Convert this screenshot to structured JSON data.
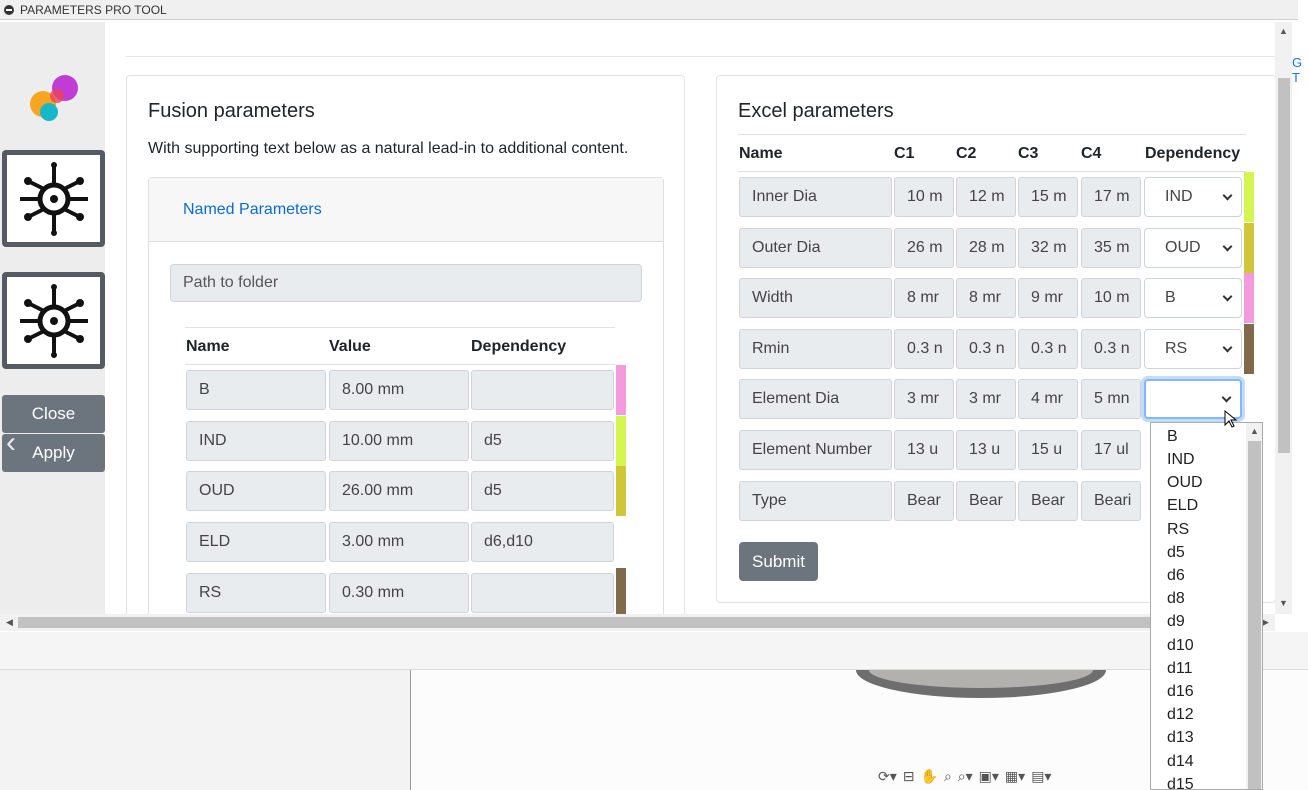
{
  "window": {
    "title": "PARAMETERS PRO TOOL",
    "edge_tab_label": "G T"
  },
  "sidebar": {
    "close_label": "Close",
    "apply_label": "Apply"
  },
  "fusion": {
    "title": "Fusion parameters",
    "lead": "With supporting text below as a natural lead-in to additional content.",
    "link": "Named Parameters",
    "path_placeholder": "Path to folder",
    "headers": [
      "Name",
      "Value",
      "Dependency"
    ],
    "rows": [
      {
        "name": "B",
        "value": "8.00 mm",
        "dependency": "",
        "color": "#f49ade"
      },
      {
        "name": "IND",
        "value": "10.00 mm",
        "dependency": "d5",
        "color": "#d5f552"
      },
      {
        "name": "OUD",
        "value": "26.00 mm",
        "dependency": "d5",
        "color": "#cfc63a"
      },
      {
        "name": "ELD",
        "value": "3.00 mm",
        "dependency": "d6,d10",
        "color": ""
      },
      {
        "name": "RS",
        "value": "0.30 mm",
        "dependency": "",
        "color": "#81694c"
      }
    ]
  },
  "excel": {
    "title": "Excel parameters",
    "headers": [
      "Name",
      "C1",
      "C2",
      "C3",
      "C4",
      "Dependency"
    ],
    "rows": [
      {
        "name": "Inner Dia",
        "c1": "10 m",
        "c2": "12 m",
        "c3": "15 m",
        "c4": "17 m",
        "dependency": "IND",
        "color": "#d5f552"
      },
      {
        "name": "Outer Dia",
        "c1": "26 m",
        "c2": "28 m",
        "c3": "32 m",
        "c4": "35 m",
        "dependency": "OUD",
        "color": "#cfc63a"
      },
      {
        "name": "Width",
        "c1": "8 mr",
        "c2": "8 mr",
        "c3": "9 mr",
        "c4": "10 m",
        "dependency": "B",
        "color": "#f49ade"
      },
      {
        "name": "Rmin",
        "c1": "0.3 n",
        "c2": "0.3 n",
        "c3": "0.3 n",
        "c4": "0.3 n",
        "dependency": "RS",
        "color": "#81694c"
      },
      {
        "name": "Element Dia",
        "c1": "3 mr",
        "c2": "3 mr",
        "c3": "4 mr",
        "c4": "5 mn",
        "dependency": "",
        "color": ""
      },
      {
        "name": "Element Number",
        "c1": "13 u",
        "c2": "13 u",
        "c3": "15 u",
        "c4": "17 ul",
        "dependency": "",
        "color": ""
      },
      {
        "name": "Type",
        "c1": "Bear",
        "c2": "Bear",
        "c3": "Bear",
        "c4": "Beari",
        "dependency": "",
        "color": ""
      }
    ],
    "submit_label": "Submit"
  },
  "dropdown_options": [
    "B",
    "IND",
    "OUD",
    "ELD",
    "RS",
    "d5",
    "d6",
    "d8",
    "d9",
    "d10",
    "d11",
    "d16",
    "d12",
    "d13",
    "d14",
    "d15"
  ],
  "toolbar_icons": [
    "orbit-icon",
    "pan-icon",
    "hand-icon",
    "zoom-icon",
    "zoom-window-icon",
    "display-icon",
    "grid-icon",
    "view-layout-icon"
  ]
}
